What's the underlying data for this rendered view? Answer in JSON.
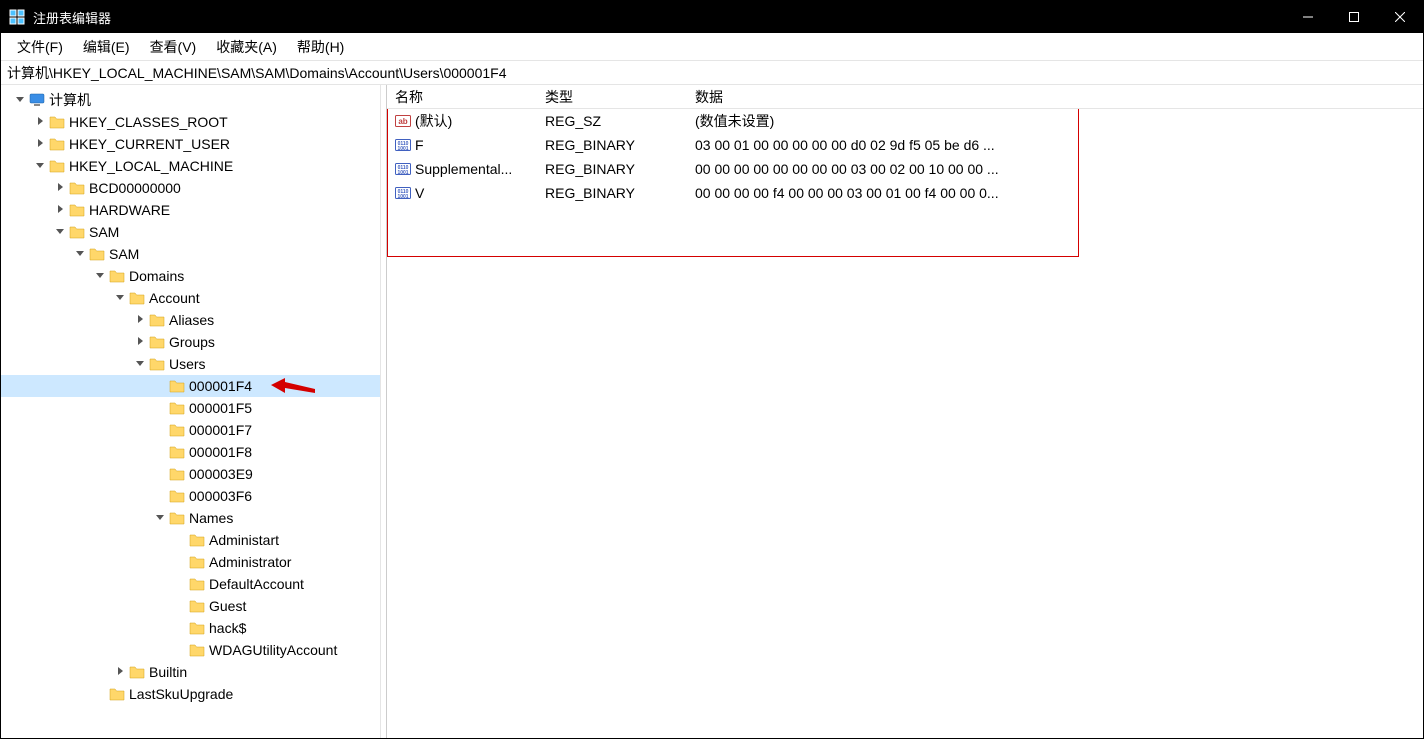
{
  "window": {
    "title": "注册表编辑器"
  },
  "menu": {
    "file": "文件(F)",
    "edit": "编辑(E)",
    "view": "查看(V)",
    "favorites": "收藏夹(A)",
    "help": "帮助(H)"
  },
  "address": {
    "path": "计算机\\HKEY_LOCAL_MACHINE\\SAM\\SAM\\Domains\\Account\\Users\\000001F4"
  },
  "tree": [
    {
      "depth": 0,
      "label": "计算机",
      "icon": "computer",
      "state": "open"
    },
    {
      "depth": 1,
      "label": "HKEY_CLASSES_ROOT",
      "icon": "folder",
      "state": "closed"
    },
    {
      "depth": 1,
      "label": "HKEY_CURRENT_USER",
      "icon": "folder",
      "state": "closed"
    },
    {
      "depth": 1,
      "label": "HKEY_LOCAL_MACHINE",
      "icon": "folder",
      "state": "open"
    },
    {
      "depth": 2,
      "label": "BCD00000000",
      "icon": "folder",
      "state": "closed"
    },
    {
      "depth": 2,
      "label": "HARDWARE",
      "icon": "folder",
      "state": "closed"
    },
    {
      "depth": 2,
      "label": "SAM",
      "icon": "folder",
      "state": "open"
    },
    {
      "depth": 3,
      "label": "SAM",
      "icon": "folder",
      "state": "open"
    },
    {
      "depth": 4,
      "label": "Domains",
      "icon": "folder",
      "state": "open"
    },
    {
      "depth": 5,
      "label": "Account",
      "icon": "folder",
      "state": "open"
    },
    {
      "depth": 6,
      "label": "Aliases",
      "icon": "folder",
      "state": "closed"
    },
    {
      "depth": 6,
      "label": "Groups",
      "icon": "folder",
      "state": "closed"
    },
    {
      "depth": 6,
      "label": "Users",
      "icon": "folder",
      "state": "open"
    },
    {
      "depth": 7,
      "label": "000001F4",
      "icon": "folder",
      "state": "leaf",
      "selected": true
    },
    {
      "depth": 7,
      "label": "000001F5",
      "icon": "folder",
      "state": "leaf"
    },
    {
      "depth": 7,
      "label": "000001F7",
      "icon": "folder",
      "state": "leaf"
    },
    {
      "depth": 7,
      "label": "000001F8",
      "icon": "folder",
      "state": "leaf"
    },
    {
      "depth": 7,
      "label": "000003E9",
      "icon": "folder",
      "state": "leaf"
    },
    {
      "depth": 7,
      "label": "000003F6",
      "icon": "folder",
      "state": "leaf"
    },
    {
      "depth": 7,
      "label": "Names",
      "icon": "folder",
      "state": "open"
    },
    {
      "depth": 8,
      "label": "Administart",
      "icon": "folder",
      "state": "leaf"
    },
    {
      "depth": 8,
      "label": "Administrator",
      "icon": "folder",
      "state": "leaf"
    },
    {
      "depth": 8,
      "label": "DefaultAccount",
      "icon": "folder",
      "state": "leaf"
    },
    {
      "depth": 8,
      "label": "Guest",
      "icon": "folder",
      "state": "leaf"
    },
    {
      "depth": 8,
      "label": "hack$",
      "icon": "folder",
      "state": "leaf"
    },
    {
      "depth": 8,
      "label": "WDAGUtilityAccount",
      "icon": "folder",
      "state": "leaf"
    },
    {
      "depth": 5,
      "label": "Builtin",
      "icon": "folder",
      "state": "closed"
    },
    {
      "depth": 4,
      "label": "LastSkuUpgrade",
      "icon": "folder",
      "state": "leaf"
    }
  ],
  "values_columns": {
    "name": "名称",
    "type": "类型",
    "data": "数据"
  },
  "values": [
    {
      "icon": "string",
      "name": "(默认)",
      "type": "REG_SZ",
      "data": "(数值未设置)"
    },
    {
      "icon": "binary",
      "name": "F",
      "type": "REG_BINARY",
      "data": "03 00 01 00 00 00 00 00 d0 02 9d f5 05 be d6 ..."
    },
    {
      "icon": "binary",
      "name": "Supplemental...",
      "type": "REG_BINARY",
      "data": "00 00 00 00 00 00 00 00 03 00 02 00 10 00 00 ..."
    },
    {
      "icon": "binary",
      "name": "V",
      "type": "REG_BINARY",
      "data": "00 00 00 00 f4 00 00 00 03 00 01 00 f4 00 00 0..."
    }
  ]
}
